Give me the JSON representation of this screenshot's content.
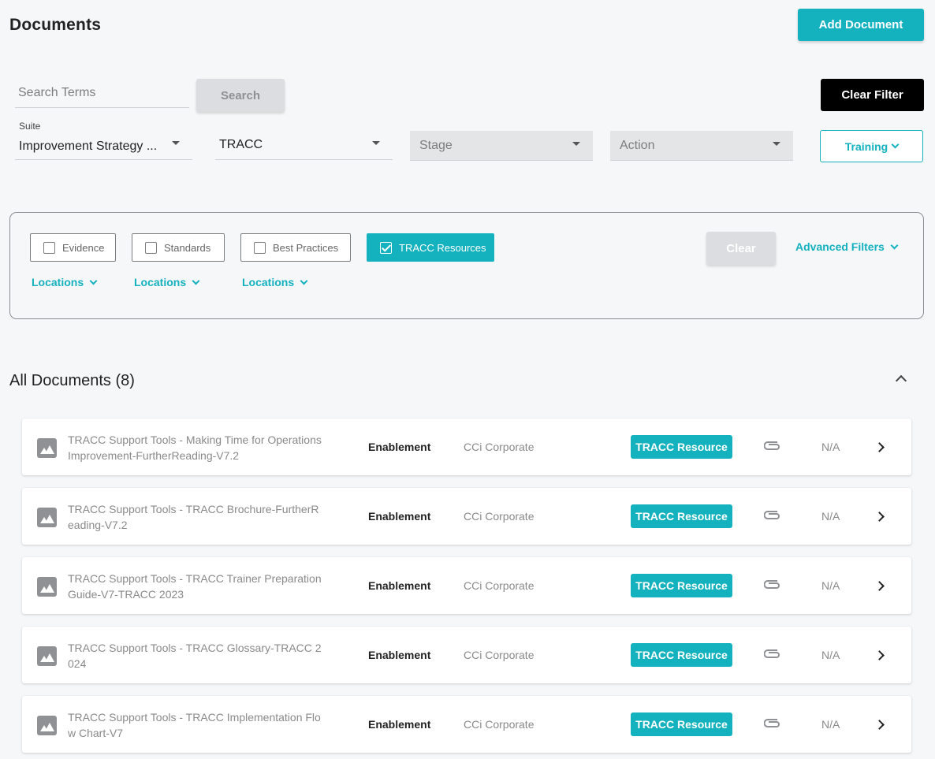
{
  "header": {
    "title": "Documents",
    "add_button": "Add Document"
  },
  "search": {
    "placeholder": "Search Terms",
    "button": "Search",
    "clear_filter": "Clear Filter"
  },
  "selects": {
    "suite_label": "Suite",
    "suite_value": "Improvement Strategy ...",
    "tracc_value": "TRACC",
    "stage_placeholder": "Stage",
    "action_placeholder": "Action",
    "training_button": "Training"
  },
  "filters": {
    "chips": [
      {
        "label": "Evidence",
        "checked": false
      },
      {
        "label": "Standards",
        "checked": false
      },
      {
        "label": "Best Practices",
        "checked": false
      },
      {
        "label": "TRACC Resources",
        "checked": true
      }
    ],
    "locations": [
      "Locations",
      "Locations",
      "Locations"
    ],
    "clear_button": "Clear",
    "advanced": "Advanced Filters"
  },
  "documents_section": {
    "title": "All Documents (8)"
  },
  "documents": [
    {
      "name": "TRACC Support Tools - Making Time for Operations Improvement-FurtherReading-V7.2",
      "category": "Enablement",
      "org": "CCi Corporate",
      "badge": "TRACC Resource",
      "status": "N/A"
    },
    {
      "name": "TRACC Support Tools - TRACC Brochure-FurtherReading-V7.2",
      "category": "Enablement",
      "org": "CCi Corporate",
      "badge": "TRACC Resource",
      "status": "N/A"
    },
    {
      "name": "TRACC Support Tools - TRACC Trainer Preparation Guide-V7-TRACC 2023",
      "category": "Enablement",
      "org": "CCi Corporate",
      "badge": "TRACC Resource",
      "status": "N/A"
    },
    {
      "name": "TRACC Support Tools - TRACC Glossary-TRACC 2024",
      "category": "Enablement",
      "org": "CCi Corporate",
      "badge": "TRACC Resource",
      "status": "N/A"
    },
    {
      "name": "TRACC Support Tools - TRACC Implementation Flow Chart-V7",
      "category": "Enablement",
      "org": "CCi Corporate",
      "badge": "TRACC Resource",
      "status": "N/A"
    }
  ],
  "colors": {
    "accent": "#14b1be",
    "background": "#f6f7f9",
    "dark_button": "#000000"
  }
}
